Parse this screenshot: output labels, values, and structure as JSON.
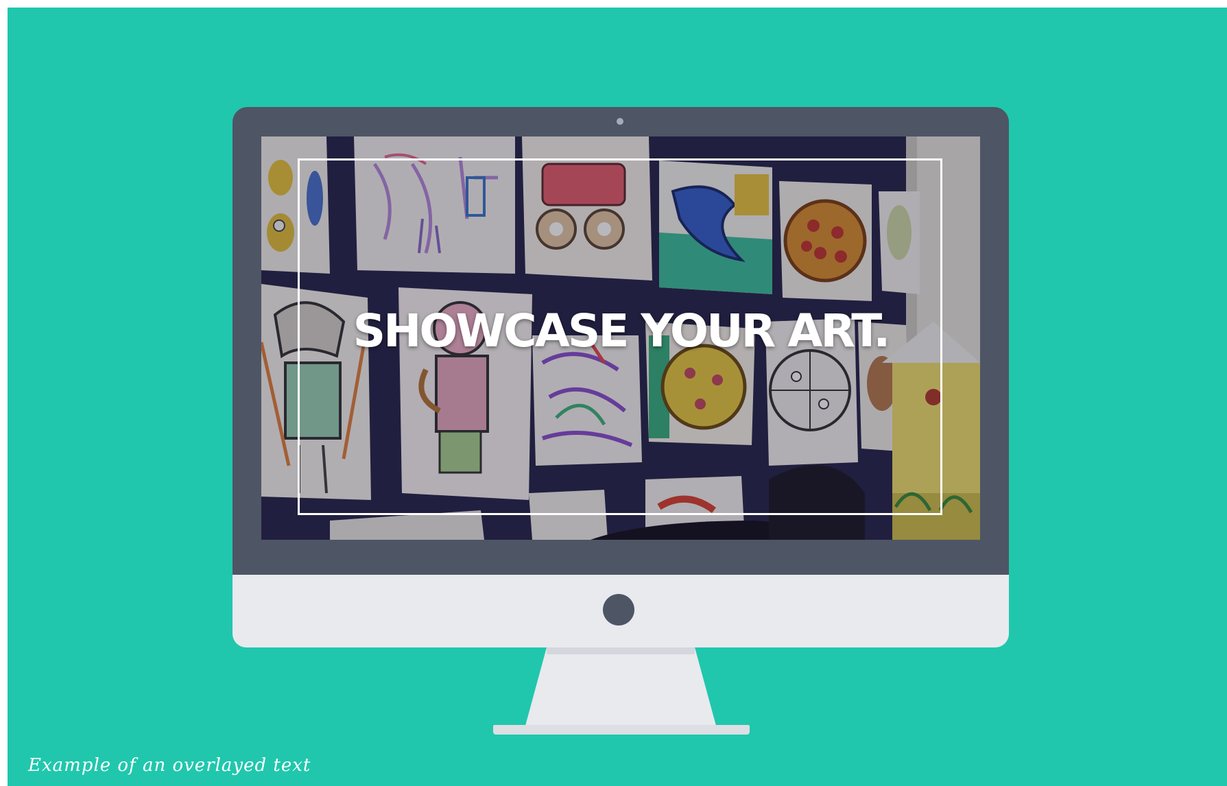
{
  "screen": {
    "headline": "SHOWCASE YOUR ART."
  },
  "caption": "Example of an overlayed text",
  "colors": {
    "background": "#20c7ad",
    "bezel": "#4e5565",
    "chin": "#e8eaee",
    "overlay_text": "#ffffff"
  },
  "icons": {
    "camera": "camera-dot-icon",
    "home_button": "home-button-icon"
  }
}
